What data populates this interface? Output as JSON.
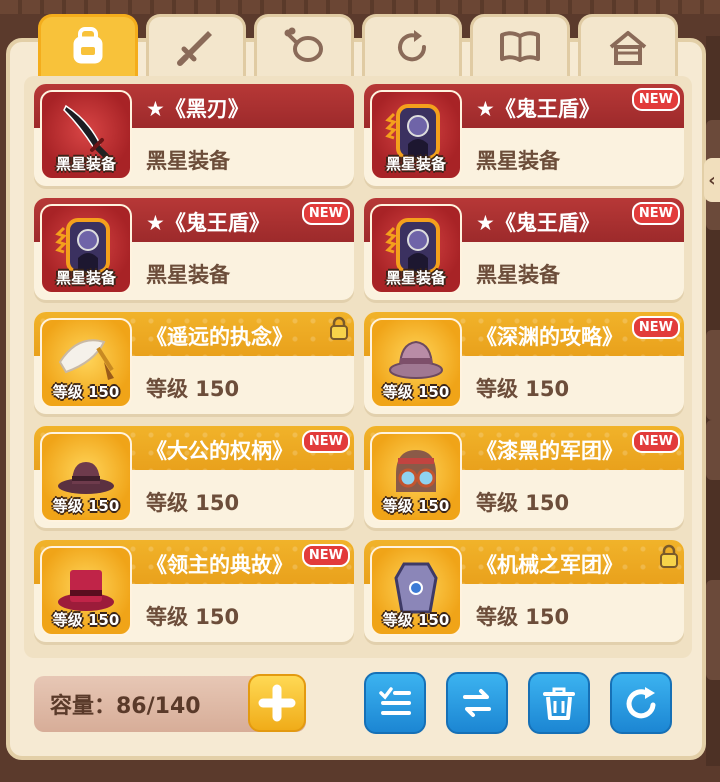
{
  "tabs": [
    {
      "name": "backpack-icon",
      "active": true
    },
    {
      "name": "sword-icon",
      "active": false
    },
    {
      "name": "meat-icon",
      "active": false
    },
    {
      "name": "refresh-icon",
      "active": false
    },
    {
      "name": "book-icon",
      "active": false
    },
    {
      "name": "home-icon",
      "active": false
    }
  ],
  "items": [
    {
      "title": "★《黑刃》",
      "subtitle": "黑星装备",
      "icon_label": "黑星装备",
      "icon": "black-blade-icon",
      "new": false,
      "locked": false,
      "style": "red"
    },
    {
      "title": "★《鬼王盾》",
      "subtitle": "黑星装备",
      "icon_label": "黑星装备",
      "icon": "ghost-king-shield-icon",
      "new": true,
      "locked": false,
      "style": "red"
    },
    {
      "title": "★《鬼王盾》",
      "subtitle": "黑星装备",
      "icon_label": "黑星装备",
      "icon": "ghost-king-shield-icon",
      "new": true,
      "locked": false,
      "style": "red"
    },
    {
      "title": "★《鬼王盾》",
      "subtitle": "黑星装备",
      "icon_label": "黑星装备",
      "icon": "ghost-king-shield-icon",
      "new": true,
      "locked": false,
      "style": "red"
    },
    {
      "title": "《遥远的执念》",
      "subtitle": "等级 150",
      "icon_label": "等级 150",
      "icon": "feather-icon",
      "new": false,
      "locked": true,
      "style": "gold"
    },
    {
      "title": "《深渊的攻略》",
      "subtitle": "等级 150",
      "icon_label": "等级 150",
      "icon": "bucket-hat-icon",
      "new": true,
      "locked": false,
      "style": "gold"
    },
    {
      "title": "《大公的权柄》",
      "subtitle": "等级 150",
      "icon_label": "等级 150",
      "icon": "fedora-hat-icon",
      "new": true,
      "locked": false,
      "style": "gold"
    },
    {
      "title": "《漆黑的军团》",
      "subtitle": "等级 150",
      "icon_label": "等级 150",
      "icon": "goggles-helmet-icon",
      "new": true,
      "locked": false,
      "style": "gold"
    },
    {
      "title": "《领主的典故》",
      "subtitle": "等级 150",
      "icon_label": "等级 150",
      "icon": "top-hat-icon",
      "new": true,
      "locked": false,
      "style": "gold"
    },
    {
      "title": "《机械之军团》",
      "subtitle": "等级 150",
      "icon_label": "等级 150",
      "icon": "mech-armor-icon",
      "new": false,
      "locked": true,
      "style": "gold"
    }
  ],
  "badges": {
    "new_label": "NEW"
  },
  "footer": {
    "capacity_label": "容量：86/140"
  },
  "colors": {
    "red_band": "#b73837",
    "gold_band": "#f1b32a",
    "action_blue": "#2a9be3",
    "plus_yellow": "#f5c030"
  }
}
